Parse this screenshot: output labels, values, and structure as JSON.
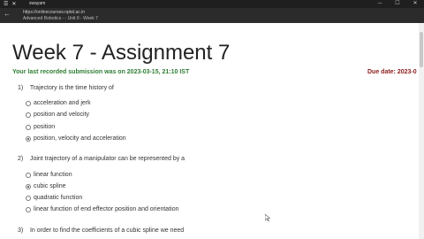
{
  "browser": {
    "window_title": "swayam",
    "url": "https://onlinecourses.nptel.ac.in",
    "breadcrumb": "Advanced Robotics - - Unit 9 - Week 7"
  },
  "page": {
    "title": "Week 7 - Assignment 7",
    "submission_note": "Your last recorded submission was on 2023-03-15, 21:10 IST",
    "due_date": "Due date: 2023-0"
  },
  "questions": [
    {
      "number": "1)",
      "text": "Trajectory is the time history of",
      "options": [
        {
          "label": "acceleration and jerk",
          "selected": false
        },
        {
          "label": "position and velocity",
          "selected": false
        },
        {
          "label": "position",
          "selected": false
        },
        {
          "label": "position, velocity and acceleration",
          "selected": true
        }
      ]
    },
    {
      "number": "2)",
      "text": "Joint trajectory of a manipulator can be represented by a",
      "options": [
        {
          "label": "linear function",
          "selected": false
        },
        {
          "label": "cubic spline",
          "selected": true
        },
        {
          "label": "quadratic function",
          "selected": false
        },
        {
          "label": "linear function of end effector position and orientation",
          "selected": false
        }
      ]
    },
    {
      "number": "3)",
      "text": "In order to find the coefficients of a cubic spline we need",
      "options": []
    }
  ]
}
